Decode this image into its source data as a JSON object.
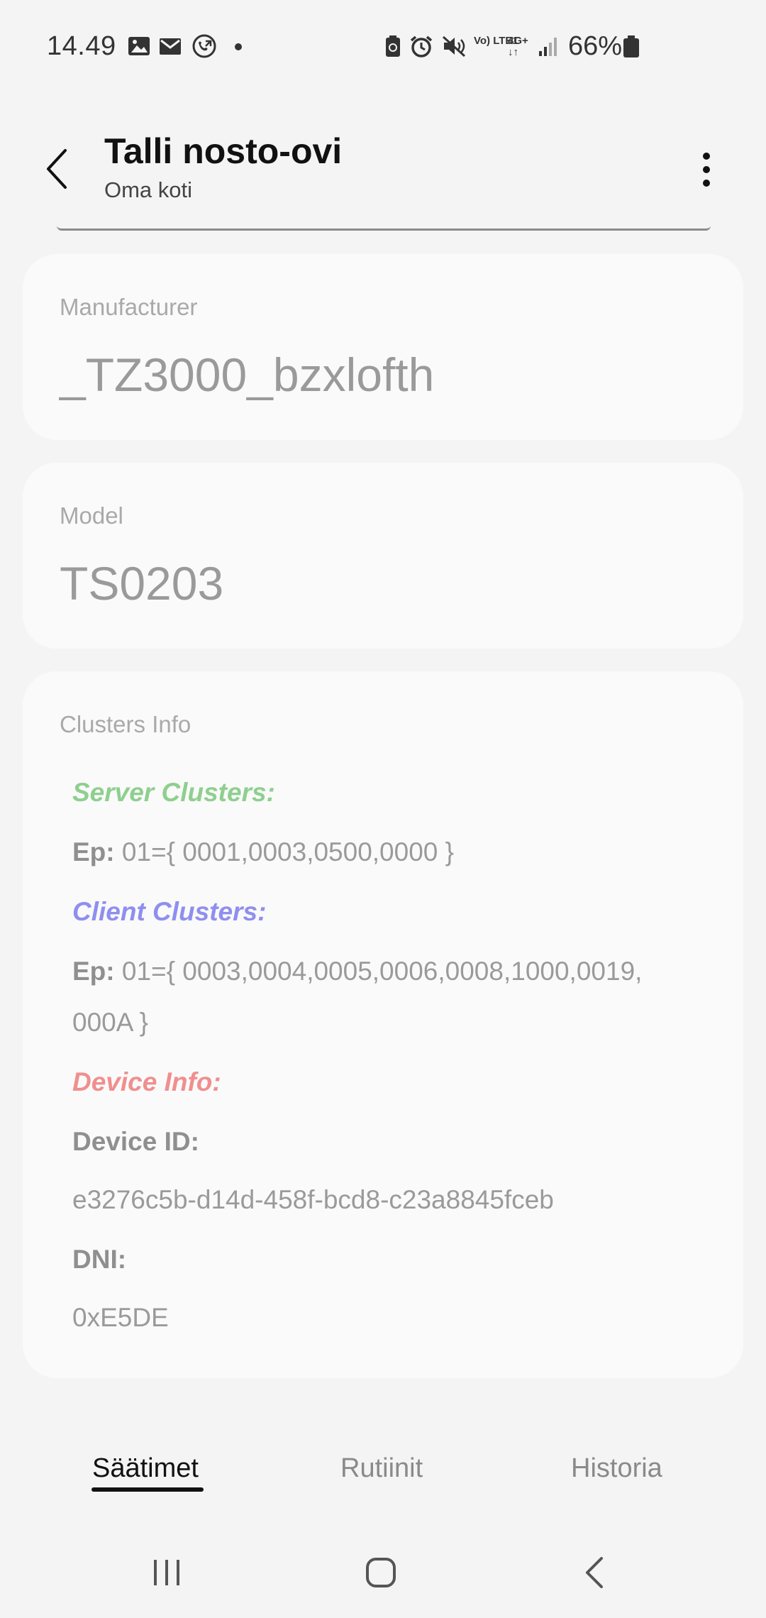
{
  "status_bar": {
    "time": "14.49",
    "battery": "66%",
    "left_icons": [
      "image-icon",
      "mail-icon",
      "call-forward-icon",
      "dot-icon"
    ],
    "right_icons": [
      "battery-saver-icon",
      "alarm-icon",
      "mute-icon",
      "volte-icon",
      "4g-icon",
      "signal-icon",
      "battery-icon"
    ],
    "volte_label": "Vo) LTE1",
    "network_label": "4G+"
  },
  "header": {
    "title": "Talli nosto-ovi",
    "subtitle": "Oma koti"
  },
  "manufacturer": {
    "label": "Manufacturer",
    "value": "_TZ3000_bzxlofth"
  },
  "model": {
    "label": "Model",
    "value": "TS0203"
  },
  "clusters": {
    "label": "Clusters Info",
    "server_heading": "Server Clusters:",
    "server_ep_label": "Ep:",
    "server_ep_value": " 01={ 0001,0003,0500,0000 }",
    "client_heading": "Client Clusters:",
    "client_ep_label": "Ep:",
    "client_ep_value": " 01={ 0003,0004,0005,0006,0008,1000,0019,",
    "client_ep_value_cont": "000A }",
    "device_heading": "Device Info:",
    "device_id_label": "Device ID:",
    "device_id_value": "e3276c5b-d14d-458f-bcd8-c23a8845fceb",
    "dni_label": "DNI:",
    "dni_value": "0xE5DE",
    "colors": {
      "server": "#8fcf8f",
      "client": "#8f8ff0",
      "device": "#f08f8f"
    }
  },
  "tabs": [
    {
      "label": "Säätimet",
      "active": true
    },
    {
      "label": "Rutiinit",
      "active": false
    },
    {
      "label": "Historia",
      "active": false
    }
  ],
  "nav_bar": {
    "icons": [
      "recent-apps-icon",
      "home-icon",
      "back-nav-icon"
    ]
  }
}
